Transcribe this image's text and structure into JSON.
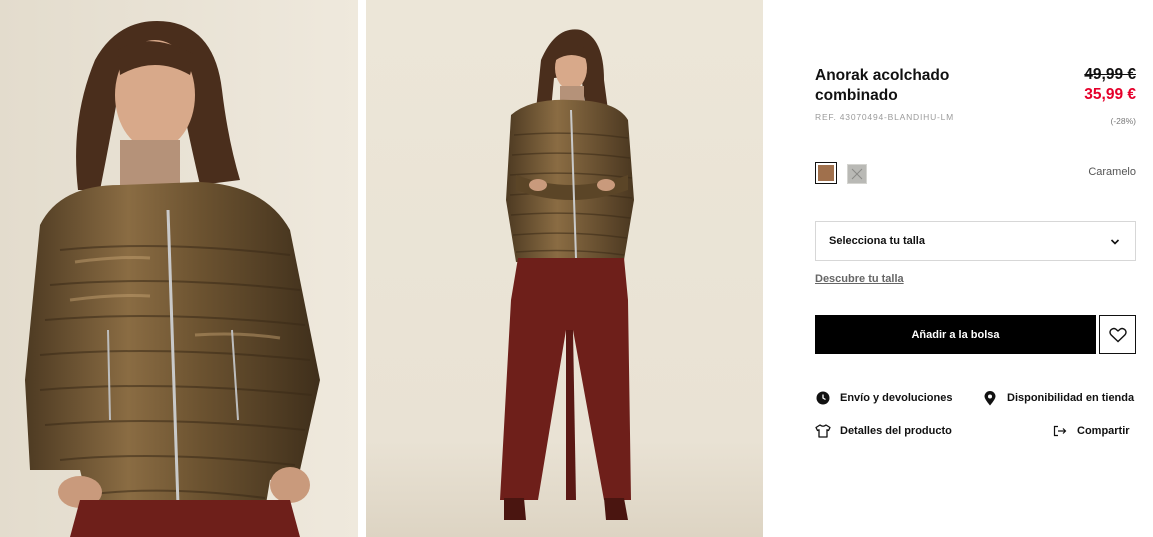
{
  "photos": [
    {
      "alt": "jacket-closeup-photo"
    },
    {
      "alt": "full-body-photo"
    }
  ],
  "product": {
    "title_line1": "Anorak acolchado",
    "title_line2": "combinado",
    "old_price": "49,99 €",
    "new_price": "35,99 €",
    "ref": "REF. 43070494-BLANDIHU-LM",
    "discount": "(-28%)",
    "selected_color": "Caramelo",
    "swatches": [
      {
        "color": "#a0704c",
        "selected": true
      },
      {
        "color": "#b9b9b5",
        "selected": false,
        "unavailable": true
      }
    ]
  },
  "size_select": {
    "label": "Selecciona tu talla",
    "link": "Descubre tu talla"
  },
  "actions": {
    "add_to_bag": "Añadir a la bolsa"
  },
  "info_links": {
    "shipping": "Envío y devoluciones",
    "store": "Disponibilidad en tienda",
    "details": "Detalles del producto",
    "share": "Compartir"
  },
  "colors": {
    "sale_red": "#e5002b",
    "button_black": "#000000",
    "jacket": "#6b5230",
    "trousers": "#6e1f1a"
  }
}
